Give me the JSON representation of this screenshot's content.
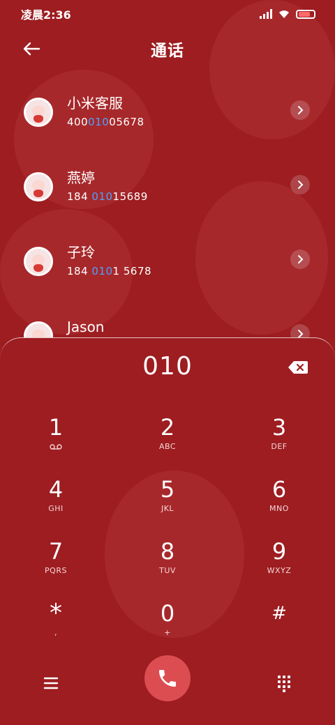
{
  "status_bar": {
    "time": "凌晨2:36"
  },
  "header": {
    "title": "通话"
  },
  "contacts": [
    {
      "name": "小米客服",
      "number_before": "400",
      "number_match": "010",
      "number_after": "05678"
    },
    {
      "name": "燕婷",
      "number_before": "184 ",
      "number_match": "010",
      "number_after": "15689"
    },
    {
      "name": "子玲",
      "number_before": "184 ",
      "number_match": "010",
      "number_after": "1 5678"
    },
    {
      "name": "Jason"
    }
  ],
  "dialer": {
    "input": "010",
    "keys": [
      {
        "digit": "1",
        "letters": "",
        "extra": "voicemail-icon"
      },
      {
        "digit": "2",
        "letters": "ABC"
      },
      {
        "digit": "3",
        "letters": "DEF"
      },
      {
        "digit": "4",
        "letters": "GHI"
      },
      {
        "digit": "5",
        "letters": "JKL"
      },
      {
        "digit": "6",
        "letters": "MNO"
      },
      {
        "digit": "7",
        "letters": "PQRS"
      },
      {
        "digit": "8",
        "letters": "TUV"
      },
      {
        "digit": "9",
        "letters": "WXYZ"
      },
      {
        "digit": "*",
        "letters": ","
      },
      {
        "digit": "0",
        "letters": "+"
      },
      {
        "digit": "#",
        "letters": ""
      }
    ]
  },
  "colors": {
    "background": "#9d1d21",
    "call_button": "#dc4d52",
    "match_highlight": "#4aa3ff"
  }
}
